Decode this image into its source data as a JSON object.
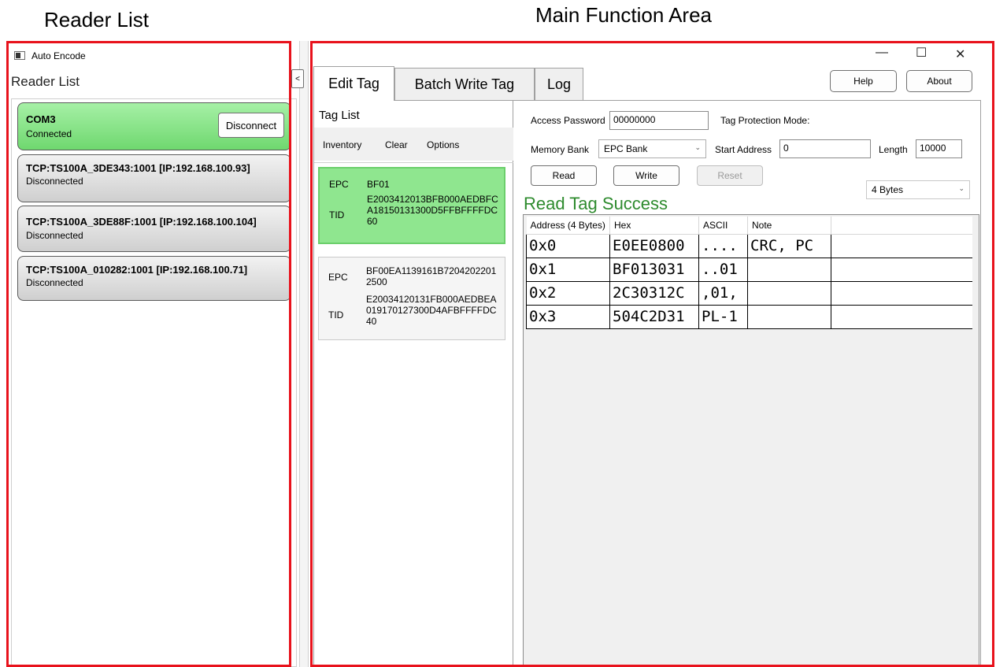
{
  "annotations": {
    "reader_list_caption": "Reader List",
    "main_area_caption": "Main Function Area",
    "box_color": "#e8121c"
  },
  "window": {
    "title": "Auto Encode",
    "minimize_glyph": "—",
    "maximize_glyph": "☐",
    "close_glyph": "✕"
  },
  "sidebar": {
    "heading": "Reader List",
    "collapse_glyph": "<",
    "readers": [
      {
        "name": "COM3",
        "status": "Connected",
        "action": "Disconnect",
        "active": true
      },
      {
        "name": "TCP:TS100A_3DE343:1001 [IP:192.168.100.93]",
        "status": "Disconnected",
        "active": false
      },
      {
        "name": "TCP:TS100A_3DE88F:1001 [IP:192.168.100.104]",
        "status": "Disconnected",
        "active": false
      },
      {
        "name": "TCP:TS100A_010282:1001 [IP:192.168.100.71]",
        "status": "Disconnected",
        "active": false
      }
    ],
    "active_color": "#8fe68f"
  },
  "header_buttons": {
    "help": "Help",
    "about": "About"
  },
  "tabs": [
    {
      "label": "Edit Tag",
      "active": true
    },
    {
      "label": "Batch Write Tag",
      "active": false
    },
    {
      "label": "Log",
      "active": false
    }
  ],
  "tag_list": {
    "heading": "Tag List",
    "toolbar": {
      "inventory": "Inventory",
      "clear": "Clear",
      "options": "Options"
    },
    "tags": [
      {
        "epc_label": "EPC",
        "epc": "BF01",
        "tid_label": "TID",
        "tid": "E2003412013BFB000AEDBFCA18150131300D5FFBFFFFDC60",
        "selected": true
      },
      {
        "epc_label": "EPC",
        "epc": "BF00EA1139161B72042022012500",
        "tid_label": "TID",
        "tid": "E20034120131FB000AEDBEA019170127300D4AFBFFFFDC40",
        "selected": false
      }
    ]
  },
  "editor": {
    "access_password_label": "Access Password",
    "access_password": "00000000",
    "protection_mode_label": "Tag Protection Mode:",
    "memory_bank_label": "Memory Bank",
    "memory_bank": "EPC Bank",
    "start_address_label": "Start Address",
    "start_address": "0",
    "length_label": "Length",
    "length": "10000",
    "read_button": "Read",
    "write_button": "Write",
    "reset_button": "Reset",
    "word_size": "4 Bytes",
    "status_message": "Read Tag Success",
    "status_color": "#2e8b2e"
  },
  "memory_table": {
    "columns": [
      "Address (4 Bytes)",
      "Hex",
      "ASCII",
      "Note"
    ],
    "rows": [
      [
        "0x0",
        "E0EE0800",
        "....",
        "CRC, PC"
      ],
      [
        "0x1",
        "BF013031",
        "..01",
        ""
      ],
      [
        "0x2",
        "2C30312C",
        ",01,",
        ""
      ],
      [
        "0x3",
        "504C2D31",
        "PL-1",
        ""
      ]
    ]
  }
}
